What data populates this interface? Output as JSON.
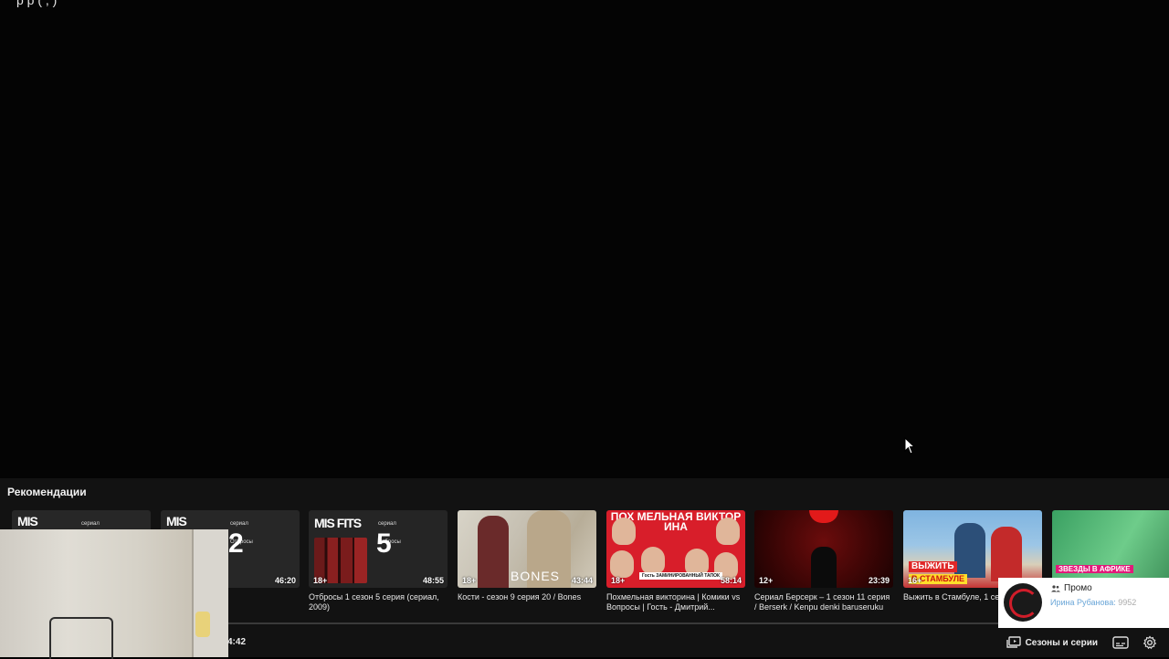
{
  "video": {
    "title_partial": "р        р (   , )"
  },
  "recommendations": {
    "heading": "Рекомендации",
    "cards": [
      {
        "poster": "MIS",
        "serial": "сериал",
        "age": "",
        "number": "",
        "duration": "",
        "caption": ""
      },
      {
        "poster": "MIS",
        "serial": "сериал",
        "sub": "Отбросы",
        "age": "",
        "number": "2",
        "duration": "46:20",
        "caption": "2 серия (сериал,"
      },
      {
        "poster": "MIS FITS",
        "serial": "сериал",
        "sub": "Отбросы",
        "age": "18+",
        "number": "5",
        "duration": "48:55",
        "caption": "Отбросы 1 сезон 5 серия (сериал, 2009)"
      },
      {
        "logo": "BONES",
        "age": "18+",
        "duration": "43:44",
        "caption": "Кости - сезон 9 серия 20 / Bones"
      },
      {
        "title": "ПОХ МЕЛЬНАЯ ВИКТОР ИНА",
        "tagline": "Гость ЗАМИНИРОВАННЫЙ ТАПОК",
        "age": "18+",
        "duration": "58:14",
        "caption": "Похмельная викторина | Комики vs Вопросы | Гость - Дмитрий..."
      },
      {
        "age": "12+",
        "duration": "23:39",
        "caption": "Сериал Берсерк – 1 сезон 11 серия / Berserk / Kenpu denki baruseruku"
      },
      {
        "label1": "ВЫЖИТЬ",
        "label2": "В СТАМБУЛЕ",
        "age": "16+",
        "caption": "Выжить в Стамбуле, 1 сез выпуск"
      },
      {
        "label": "ЗВЕЗДЫ В АФРИКЕ",
        "caption": ""
      }
    ]
  },
  "player": {
    "time_current": "4:42",
    "progress": 0.0,
    "seasons_label": "Сезоны и серии"
  },
  "promo": {
    "type": "Промо",
    "user": "Ирина Рубанова:",
    "count": "9952"
  }
}
